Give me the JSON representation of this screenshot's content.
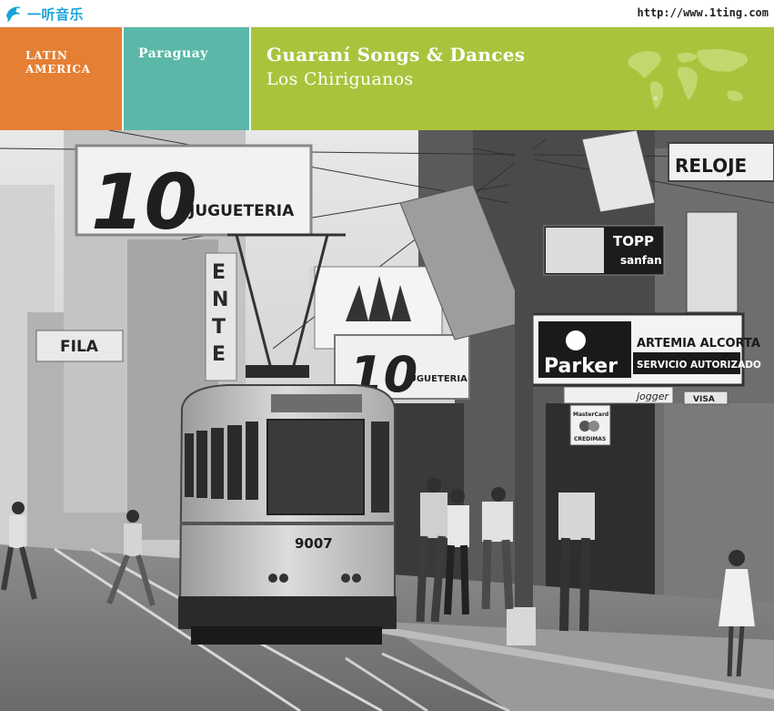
{
  "site": {
    "logo_text": "一听音乐",
    "url": "http://www.1ting.com"
  },
  "header": {
    "region_line1": "LATIN",
    "region_line2": "AMERICA",
    "country": "Paraguay",
    "album_title": "Guaraní Songs & Dances",
    "artist": "Los Chiriguanos"
  },
  "photo": {
    "signs": {
      "big_number": "10",
      "jugueteria": "JUGUETERIA",
      "big_number_2": "10",
      "jugueteria_2": "JUGUETERIA",
      "reloje": "RELOJE",
      "fila": "FILA",
      "topp": "TOPP",
      "sanfan": "sanfan",
      "parker": "Parker",
      "artemia": "ARTEMIA ALCORTA",
      "servicio": "SERVICIO AUTORIZADO",
      "jogger": "jogger",
      "visa": "VISA",
      "mastercard": "MasterCard",
      "credimas": "CREDIMAS",
      "tram_number": "9007"
    }
  },
  "colors": {
    "region_bg": "#e57f34",
    "country_bg": "#5bb8a8",
    "title_bg": "#a9c43c",
    "logo_blue": "#1aa3d8"
  }
}
